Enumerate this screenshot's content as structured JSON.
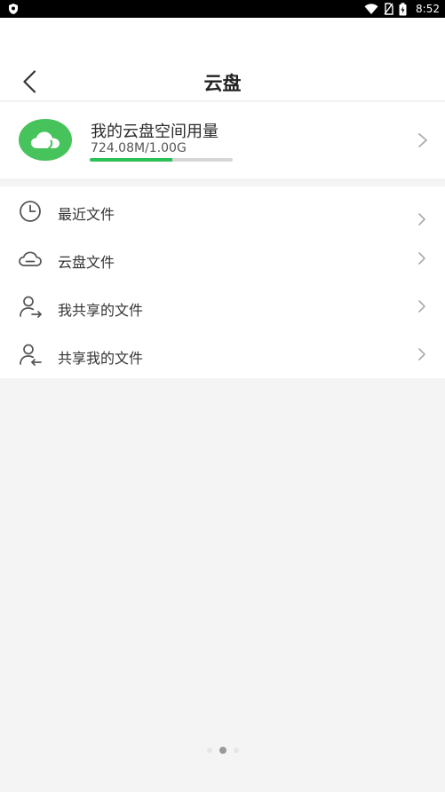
{
  "status_bar": {
    "time": "8:52",
    "icons": [
      "shield-icon",
      "wifi-icon",
      "no-sim-icon",
      "battery-charging-icon"
    ]
  },
  "header": {
    "title": "云盘",
    "back_icon": "back-arrow-icon"
  },
  "usage": {
    "title": "我的云盘空间用量",
    "value": "724.08M/1.00G",
    "used_fraction": 0.58,
    "icon": "cloud-icon",
    "accent": "#46c35a",
    "bar_color": "#2cc056"
  },
  "menu": {
    "items": [
      {
        "label": "最近文件",
        "icon": "clock-icon"
      },
      {
        "label": "云盘文件",
        "icon": "cloud-outline-icon"
      },
      {
        "label": "我共享的文件",
        "icon": "user-share-out-icon"
      },
      {
        "label": "共享我的文件",
        "icon": "user-share-in-icon"
      }
    ]
  },
  "pager": {
    "count": 3,
    "active": 1
  }
}
